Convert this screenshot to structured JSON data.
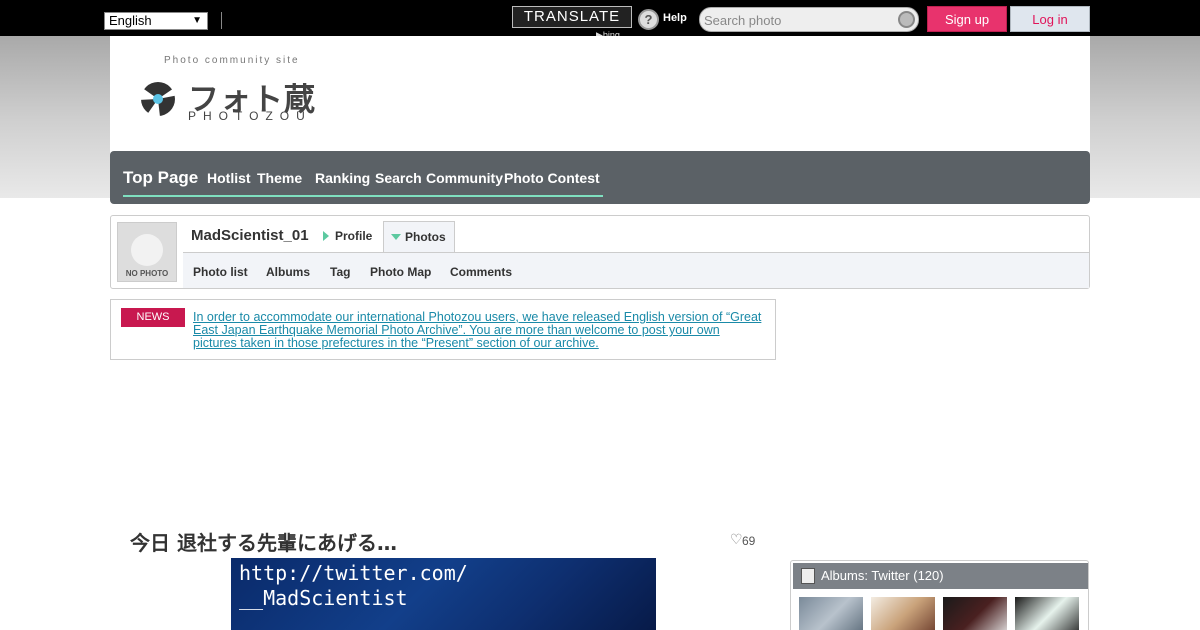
{
  "topbar": {
    "language": "English",
    "translate_label": "TRANSLATE",
    "powered_by": "bing",
    "help_label": "Help",
    "search_placeholder": "Search photo",
    "signup_label": "Sign up",
    "login_label": "Log in"
  },
  "header": {
    "tagline": "Photo community site",
    "logo_text": "フォト蔵",
    "logo_subtext": "PHOTOZOU"
  },
  "nav": {
    "items": [
      {
        "label": "Top Page"
      },
      {
        "label": "Hotlist"
      },
      {
        "label": "Theme"
      },
      {
        "label": "Ranking"
      },
      {
        "label": "Search"
      },
      {
        "label": "Community"
      },
      {
        "label": "Photo Contest"
      }
    ]
  },
  "profile": {
    "username": "MadScientist_01",
    "avatar_caption": "NO PHOTO",
    "tabs": {
      "profile": "Profile",
      "photos": "Photos"
    },
    "subnav": [
      {
        "label": "Photo list"
      },
      {
        "label": "Albums"
      },
      {
        "label": "Tag"
      },
      {
        "label": "Photo Map"
      },
      {
        "label": "Comments"
      }
    ]
  },
  "news": {
    "badge": "NEWS",
    "text": "In order to accommodate our international Photozou users, we have released English version of “Great East Japan Earthquake Memorial Photo Archive”. You are more than welcome to post your own pictures taken in those prefectures in the “Present” section of our archive."
  },
  "photo": {
    "title": "今日 退社する先輩にあげる…",
    "favorite_count": "69",
    "overlay_line1": "http://twitter.com/",
    "overlay_line2": "__MadScientist"
  },
  "sidebar": {
    "albums_label": "Albums: Twitter",
    "albums_count": "(120)"
  },
  "colors": {
    "signup": "#e8336d",
    "news_badge": "#c8184f",
    "nav_bg": "#5b6166",
    "nav_accent": "#7fe0c0",
    "link": "#1a8aa8"
  }
}
